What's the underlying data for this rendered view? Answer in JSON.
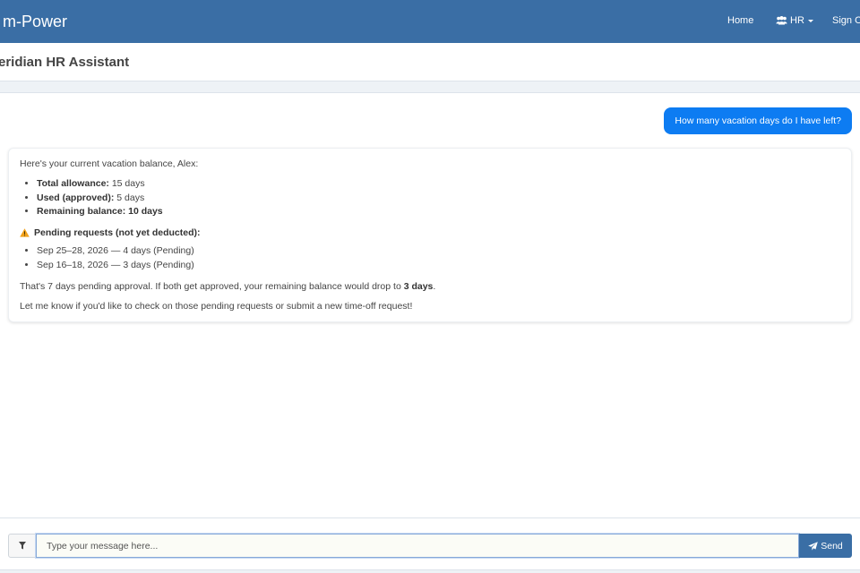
{
  "navbar": {
    "brand": "m-Power",
    "links": {
      "home": "Home",
      "hr": "HR",
      "signout": "Sign O"
    },
    "background": "#3a6ea5"
  },
  "header": {
    "title": "eridian HR Assistant"
  },
  "chat": {
    "user_message": "How many vacation days do I have left?",
    "bot": {
      "intro": "Here's your current vacation balance, Alex:",
      "summary": [
        {
          "label": "Total allowance:",
          "value": "15 days"
        },
        {
          "label": "Used (approved):",
          "value": "5 days"
        },
        {
          "label": "Remaining balance: 10 days",
          "value": ""
        }
      ],
      "pending_heading": "Pending requests (not yet deducted):",
      "pending": [
        "Sep 25–28, 2026 — 4 days (Pending)",
        "Sep 16–18, 2026 — 3 days (Pending)"
      ],
      "note_prefix": "That's 7 days pending approval. If both get approved, your remaining balance would drop to ",
      "note_bold": "3 days",
      "note_suffix": ".",
      "closing": "Let me know if you'd like to check on those pending requests or submit a new time-off request!"
    },
    "user_bubble_color": "#0d7cf2"
  },
  "composer": {
    "placeholder": "Type your message here...",
    "value": "",
    "send_label": "Send"
  },
  "icons": {
    "hr": "users-icon",
    "warning": "warning-icon",
    "filter": "filter-icon",
    "send": "paper-plane-icon"
  }
}
